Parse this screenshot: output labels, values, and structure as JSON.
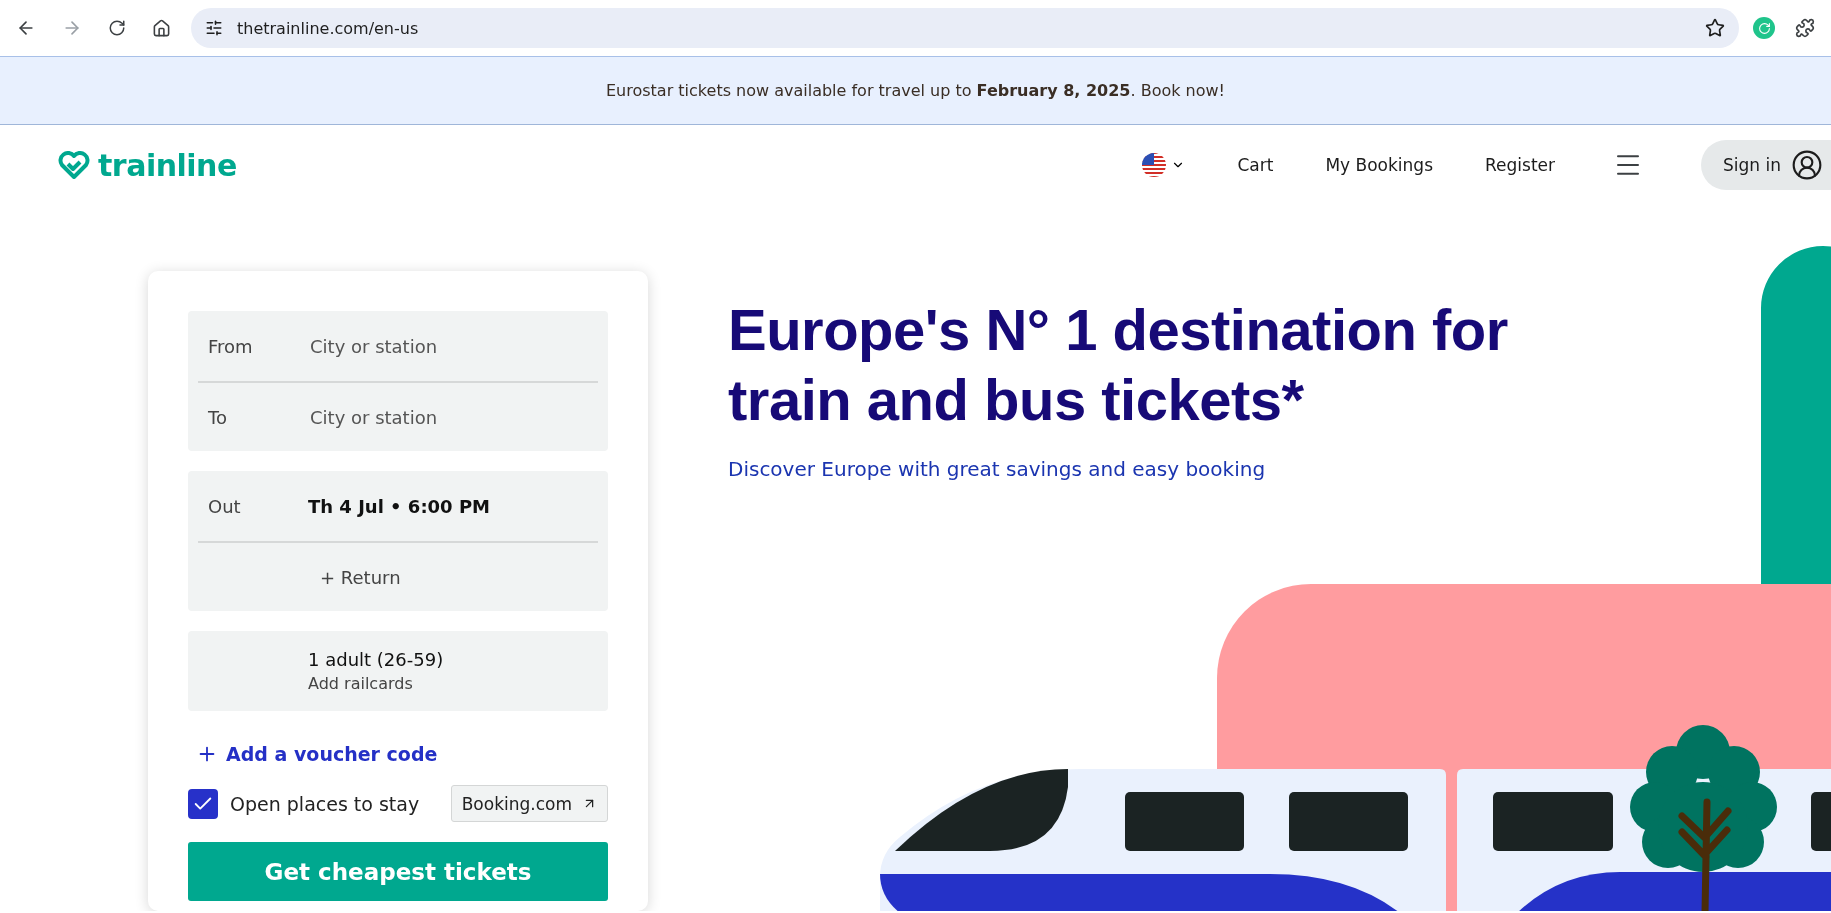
{
  "browser": {
    "url": "thetrainline.com/en-us"
  },
  "banner": {
    "text": "Eurostar tickets now available for travel up to **February 8, 2025**. Book now!"
  },
  "header": {
    "logo": "trainline",
    "nav": [
      "Cart",
      "My Bookings",
      "Register"
    ],
    "sign_in": "Sign in"
  },
  "search": {
    "journey": [
      {
        "label": "From",
        "placeholder": "City or station"
      },
      {
        "label": "To",
        "placeholder": "City or station"
      }
    ],
    "dates": {
      "out_label": "Out",
      "out_value": "Th 4 Jul • 6:00 PM",
      "return": "+ Return"
    },
    "passengers": {
      "summary": "1 adult (26-59)",
      "railcards": "Add railcards"
    },
    "voucher": "Add a voucher code",
    "stay": {
      "label": "Open places to stay",
      "checked": true,
      "partner": "Booking.com"
    },
    "submit": "Get cheapest tickets"
  },
  "hero": {
    "title": "Europe's N° 1 destination for train and bus tickets*",
    "subtitle": "Discover Europe with great savings and easy booking"
  }
}
